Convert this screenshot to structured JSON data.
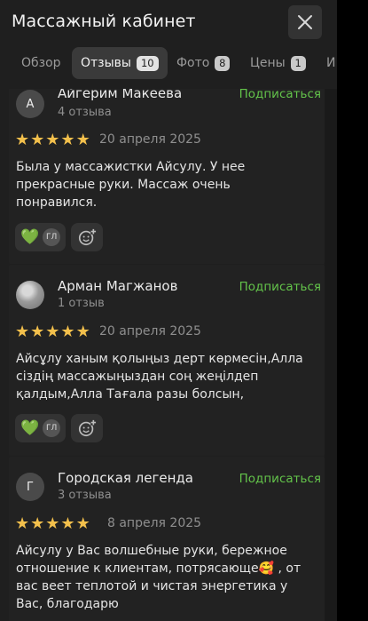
{
  "header": {
    "title": "Массажный кабинет"
  },
  "tabs": [
    {
      "label": "Обзор",
      "count": ""
    },
    {
      "label": "Отзывы",
      "count": "10"
    },
    {
      "label": "Фото",
      "count": "8"
    },
    {
      "label": "Цены",
      "count": "1"
    },
    {
      "label": "И",
      "count": ""
    }
  ],
  "reviews": [
    {
      "avatar_letter": "А",
      "name": "Айгерим Макеева",
      "review_count": "4 отзыва",
      "subscribe_label": "Подписаться",
      "rating": 5,
      "date": "20 апреля 2025",
      "text": "Была у массажистки Айсулу. У нее прекрасные руки. Массаж очень понравился.",
      "reaction_emoji": "💚",
      "reaction_user": "ГЛ"
    },
    {
      "avatar_letter": "",
      "name": "Арман Магжанов",
      "review_count": "1 отзыв",
      "subscribe_label": "Подписаться",
      "rating": 5,
      "date": "20 апреля 2025",
      "text": "Айсұлу ханым қолыңыз дерт көрмесін,Алла сіздің массажыңыздан соң жеңілдеп қалдым,Алла Тағала разы болсын,",
      "reaction_emoji": "💚",
      "reaction_user": "ГЛ"
    },
    {
      "avatar_letter": "Г",
      "name": "Городская легенда",
      "review_count": "3 отзыва",
      "subscribe_label": "Подписаться",
      "rating": 5,
      "date": "8 апреля 2025",
      "text": "Айсулу у Вас волшебные руки, бережное отношение к клиентам, потрясающе🥰 , от вас веет теплотой и чистая энергетика у Вас, благодарю",
      "reaction_emoji": "",
      "reaction_user": ""
    }
  ],
  "colors": {
    "accent_green": "#63c34a",
    "star": "#f3c04c",
    "background": "#1f1f1f"
  },
  "icons": {
    "close": "close-icon",
    "star": "star-icon",
    "add_reaction": "add-reaction-icon"
  }
}
